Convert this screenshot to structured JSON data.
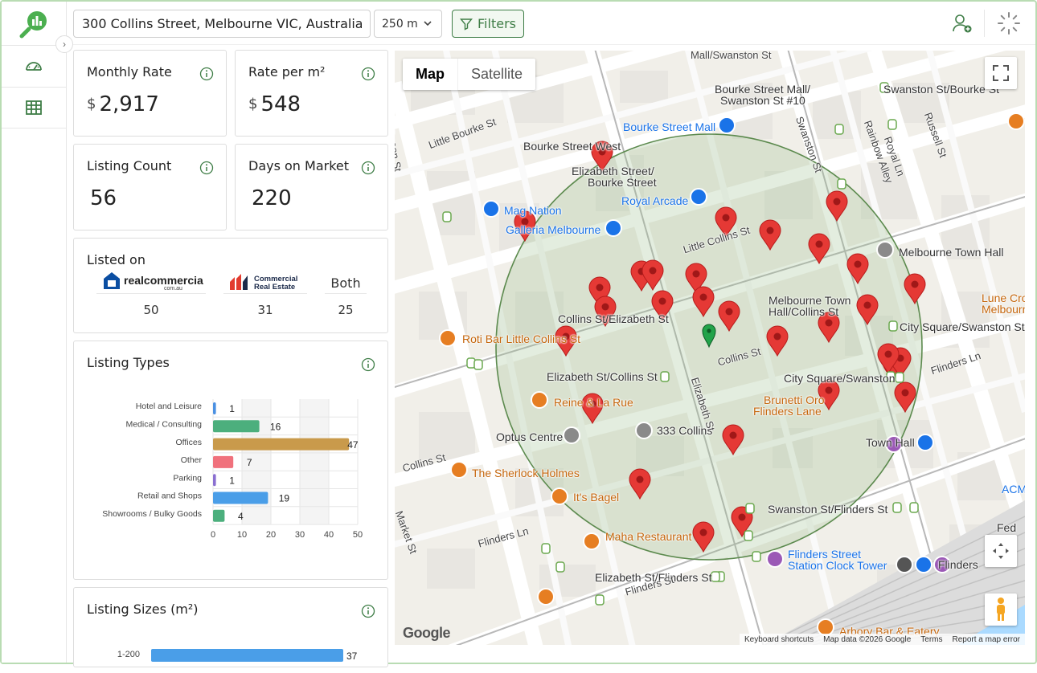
{
  "topbar": {
    "address": "300 Collins Street, Melbourne VIC, Australia",
    "radius": "250 m",
    "filters_label": "Filters"
  },
  "sidebar": {
    "items": [
      {
        "name": "dashboard",
        "icon": "speedometer-icon"
      },
      {
        "name": "table",
        "icon": "table-icon"
      }
    ],
    "collapse_glyph": "›"
  },
  "stats": {
    "monthly_rate": {
      "label": "Monthly Rate",
      "currency": "$",
      "value": "2,917"
    },
    "rate_per_m2": {
      "label": "Rate per m²",
      "currency": "$",
      "value": "548"
    },
    "listing_count": {
      "label": "Listing Count",
      "value": "56"
    },
    "days_on_market": {
      "label": "Days on Market",
      "value": "220"
    }
  },
  "listed_on": {
    "title": "Listed on",
    "platforms": [
      {
        "name": "realcommercial",
        "sub": "com.au",
        "count": "50"
      },
      {
        "name": "Commercial Real Estate",
        "line1": "Commercial",
        "line2": "Real Estate",
        "count": "31"
      },
      {
        "name": "Both",
        "count": "25"
      }
    ]
  },
  "listing_types": {
    "title": "Listing Types",
    "chart_data": {
      "type": "bar",
      "orientation": "horizontal",
      "categories": [
        "Hotel and Leisure",
        "Medical / Consulting",
        "Offices",
        "Other",
        "Parking",
        "Retail and Shops",
        "Showrooms / Bulky Goods"
      ],
      "values": [
        1,
        16,
        47,
        7,
        1,
        19,
        4
      ],
      "colors": [
        "#4a90e2",
        "#4caf7d",
        "#c99a4b",
        "#f0717c",
        "#8a6fd1",
        "#4a9ee8",
        "#4caf7d"
      ],
      "xlim": [
        0,
        50
      ],
      "xticks": [
        "0",
        "10",
        "20",
        "30",
        "40",
        "50"
      ]
    }
  },
  "listing_sizes": {
    "title": "Listing Sizes (m²)",
    "chart_data": {
      "type": "bar",
      "orientation": "horizontal",
      "categories": [
        "1-200"
      ],
      "values": [
        37
      ],
      "colors": [
        "#4a9ee8"
      ]
    }
  },
  "map": {
    "map_tab": "Map",
    "satellite_tab": "Satellite",
    "google": "Google",
    "footer": [
      "Keyboard shortcuts",
      "Map data ©2026 Google",
      "Terms",
      "Report a map error"
    ],
    "labels": [
      {
        "text": "Mall/Swanston St",
        "cls": "street"
      },
      {
        "text": "Bourke Street Mall/",
        "cls": ""
      },
      {
        "text": "Swanston St #10",
        "cls": ""
      },
      {
        "text": "Swanston St/Bourke St",
        "cls": ""
      },
      {
        "text": "Bourke Street Mall",
        "cls": "blue"
      },
      {
        "text": "Bourke Street West",
        "cls": ""
      },
      {
        "text": "Elizabeth Street/",
        "cls": ""
      },
      {
        "text": "Bourke Street",
        "cls": ""
      },
      {
        "text": "Royal Arcade",
        "cls": "blue"
      },
      {
        "text": "Mag Nation",
        "cls": "blue"
      },
      {
        "text": "Galleria Melbourne",
        "cls": "blue"
      },
      {
        "text": "Melbourne Town Hall",
        "cls": ""
      },
      {
        "text": "Little Collins St",
        "cls": "street"
      },
      {
        "text": "Melbourne Town",
        "cls": ""
      },
      {
        "text": "Hall/Collins St",
        "cls": ""
      },
      {
        "text": "City Square/Swanston St",
        "cls": ""
      },
      {
        "text": "Collins St/Elizabeth St",
        "cls": ""
      },
      {
        "text": "Roti Bar Little Collins St",
        "cls": "orange"
      },
      {
        "text": "Elizabeth St/Collins St",
        "cls": ""
      },
      {
        "text": "Collins St",
        "cls": "street"
      },
      {
        "text": "City Square/Swanston",
        "cls": ""
      },
      {
        "text": "Reine & La Rue",
        "cls": "orange"
      },
      {
        "text": "Brunetti Oro",
        "cls": "orange"
      },
      {
        "text": "Flinders Lane",
        "cls": "orange"
      },
      {
        "text": "Optus Centre",
        "cls": ""
      },
      {
        "text": "333 Collins",
        "cls": ""
      },
      {
        "text": "Town Hall",
        "cls": ""
      },
      {
        "text": "The Sherlock Holmes",
        "cls": "orange"
      },
      {
        "text": "It's Bagel",
        "cls": "orange"
      },
      {
        "text": "Swanston St/Flinders St",
        "cls": ""
      },
      {
        "text": "Maha Restaurant",
        "cls": "orange"
      },
      {
        "text": "Flinders Street",
        "cls": "blue"
      },
      {
        "text": "Station Clock Tower",
        "cls": "blue"
      },
      {
        "text": "Elizabeth St/Flinders St",
        "cls": ""
      },
      {
        "text": "Flinders St",
        "cls": "street"
      },
      {
        "text": "Arbory Bar & Eatery",
        "cls": "orange"
      },
      {
        "text": "Lune Cro",
        "cls": "orange"
      },
      {
        "text": "Melbourne",
        "cls": "orange"
      },
      {
        "text": "Queen St",
        "cls": "street"
      },
      {
        "text": "Little Bourke St",
        "cls": "street"
      },
      {
        "text": "Elizabeth St",
        "cls": "street"
      },
      {
        "text": "Swanston St",
        "cls": "street"
      },
      {
        "text": "Russell St",
        "cls": "street"
      },
      {
        "text": "Royal Ln",
        "cls": "street"
      },
      {
        "text": "Rainbow Alley",
        "cls": "street"
      },
      {
        "text": "Flinders Ln",
        "cls": "street"
      },
      {
        "text": "Market St",
        "cls": "street"
      },
      {
        "text": "Collins St",
        "cls": "street"
      },
      {
        "text": "Flinders Ln",
        "cls": "street"
      },
      {
        "text": "ACM",
        "cls": "blue"
      },
      {
        "text": "Fed",
        "cls": ""
      },
      {
        "text": "Flinders",
        "cls": ""
      }
    ]
  }
}
